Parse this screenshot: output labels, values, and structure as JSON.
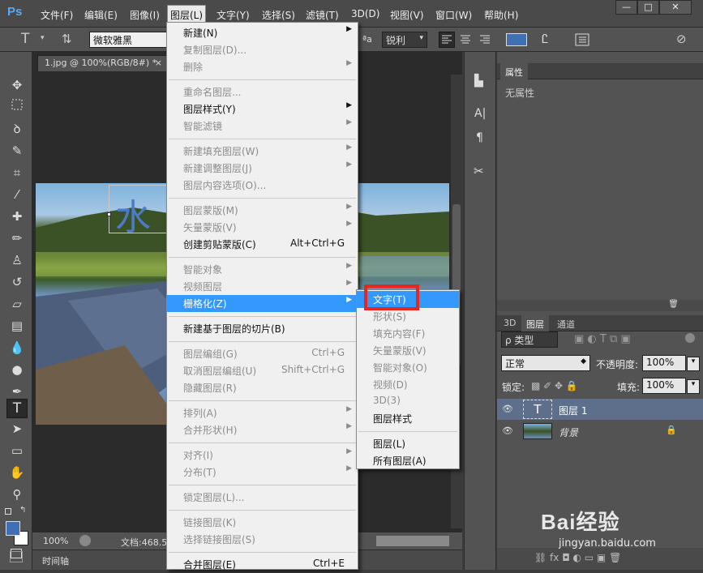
{
  "app": {
    "logo": "Ps",
    "menus": [
      "文件(F)",
      "编辑(E)",
      "图像(I)",
      "图层(L)",
      "文字(Y)",
      "选择(S)",
      "滤镜(T)",
      "3D(D)",
      "视图(V)",
      "窗口(W)",
      "帮助(H)"
    ],
    "window_buttons": [
      "—",
      "□",
      "✕"
    ]
  },
  "options": {
    "tool_glyph": "T",
    "font_family": "微软雅黑",
    "aa_label": "ªa",
    "aa_value": "锐利"
  },
  "document": {
    "tab_title": "1.jpg @ 100%(RGB/8#) *",
    "zoom": "100%",
    "doc_info": "文档:468.5",
    "timeline_label": "时间轴",
    "text_preview": "水"
  },
  "layer_menu": [
    {
      "label": "新建(N)",
      "arrow": true,
      "disabled": false
    },
    {
      "label": "复制图层(D)...",
      "disabled": true
    },
    {
      "label": "删除",
      "arrow": true,
      "disabled": true
    },
    {
      "sep": true
    },
    {
      "label": "重命名图层...",
      "disabled": true
    },
    {
      "label": "图层样式(Y)",
      "arrow": true,
      "disabled": false
    },
    {
      "label": "智能滤镜",
      "arrow": true,
      "disabled": true
    },
    {
      "sep": true
    },
    {
      "label": "新建填充图层(W)",
      "arrow": true,
      "disabled": true
    },
    {
      "label": "新建调整图层(J)",
      "arrow": true,
      "disabled": true
    },
    {
      "label": "图层内容选项(O)...",
      "disabled": true
    },
    {
      "sep": true
    },
    {
      "label": "图层蒙版(M)",
      "arrow": true,
      "disabled": true
    },
    {
      "label": "矢量蒙版(V)",
      "arrow": true,
      "disabled": true
    },
    {
      "label": "创建剪贴蒙版(C)",
      "shortcut": "Alt+Ctrl+G",
      "disabled": false
    },
    {
      "sep": true
    },
    {
      "label": "智能对象",
      "arrow": true,
      "disabled": true
    },
    {
      "label": "视频图层",
      "arrow": true,
      "disabled": true
    },
    {
      "label": "栅格化(Z)",
      "arrow": true,
      "disabled": false,
      "highlight": true
    },
    {
      "sep": true
    },
    {
      "label": "新建基于图层的切片(B)",
      "disabled": false
    },
    {
      "sep": true
    },
    {
      "label": "图层编组(G)",
      "shortcut": "Ctrl+G",
      "disabled": true
    },
    {
      "label": "取消图层编组(U)",
      "shortcut": "Shift+Ctrl+G",
      "disabled": true
    },
    {
      "label": "隐藏图层(R)",
      "disabled": true
    },
    {
      "sep": true
    },
    {
      "label": "排列(A)",
      "arrow": true,
      "disabled": true
    },
    {
      "label": "合并形状(H)",
      "arrow": true,
      "disabled": true
    },
    {
      "sep": true
    },
    {
      "label": "对齐(I)",
      "arrow": true,
      "disabled": true
    },
    {
      "label": "分布(T)",
      "arrow": true,
      "disabled": true
    },
    {
      "sep": true
    },
    {
      "label": "锁定图层(L)...",
      "disabled": true
    },
    {
      "sep": true
    },
    {
      "label": "链接图层(K)",
      "disabled": true
    },
    {
      "label": "选择链接图层(S)",
      "disabled": true
    },
    {
      "sep": true
    },
    {
      "label": "合并图层(E)",
      "shortcut": "Ctrl+E",
      "disabled": false
    }
  ],
  "rasterize_menu": [
    {
      "label": "文字(T)",
      "disabled": false,
      "highlight": true
    },
    {
      "label": "形状(S)",
      "disabled": true
    },
    {
      "label": "填充内容(F)",
      "disabled": true
    },
    {
      "label": "矢量蒙版(V)",
      "disabled": true
    },
    {
      "label": "智能对象(O)",
      "disabled": true
    },
    {
      "label": "视频(D)",
      "disabled": true
    },
    {
      "label": "3D(3)",
      "disabled": true
    },
    {
      "label": "图层样式",
      "disabled": false
    },
    {
      "sep": true
    },
    {
      "label": "图层(L)",
      "disabled": false
    },
    {
      "label": "所有图层(A)",
      "disabled": false
    }
  ],
  "properties_panel": {
    "tab": "属性",
    "empty_text": "无属性"
  },
  "layers_panel": {
    "tabs": [
      "3D",
      "图层",
      "通道"
    ],
    "filter_label": "ρ 类型",
    "blend_mode": "正常",
    "opacity_label": "不透明度:",
    "opacity_value": "100%",
    "lock_label": "锁定:",
    "fill_label": "填充:",
    "fill_value": "100%",
    "layers": [
      {
        "name": "图层 1",
        "thumb": "T",
        "selected": true
      },
      {
        "name": "背景",
        "locked": true
      }
    ]
  },
  "watermark": {
    "brand": "Bai经验",
    "url": "jingyan.baidu.com"
  },
  "colors": {
    "highlight": "#3399ff",
    "callout": "#e8261f",
    "foreground": "#3f6fb4"
  }
}
